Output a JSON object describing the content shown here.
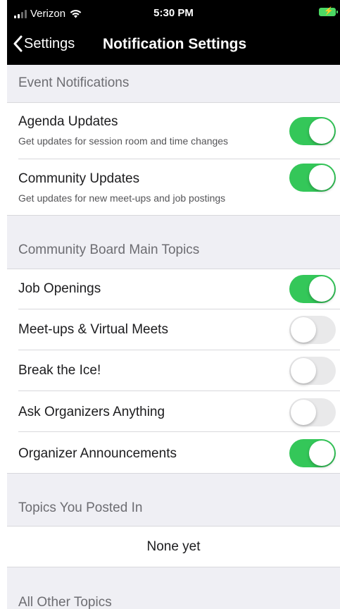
{
  "status_bar": {
    "carrier": "Verizon",
    "time": "5:30 PM",
    "battery_color": "#4cd964"
  },
  "nav": {
    "back_label": "Settings",
    "title": "Notification Settings"
  },
  "sections": {
    "event": {
      "header": "Event Notifications",
      "items": [
        {
          "title": "Agenda Updates",
          "subtitle": "Get updates for session room and time changes",
          "enabled": true
        },
        {
          "title": "Community Updates",
          "subtitle": "Get updates for new meet-ups and job postings",
          "enabled": true
        }
      ]
    },
    "community_board": {
      "header": "Community Board Main Topics",
      "items": [
        {
          "title": "Job Openings",
          "enabled": true
        },
        {
          "title": "Meet-ups & Virtual Meets",
          "enabled": false
        },
        {
          "title": "Break the Ice!",
          "enabled": false
        },
        {
          "title": "Ask Organizers Anything",
          "enabled": false
        },
        {
          "title": "Organizer Announcements",
          "enabled": true
        }
      ]
    },
    "posted_in": {
      "header": "Topics You Posted In",
      "empty_text": "None yet"
    },
    "other": {
      "header": "All Other Topics"
    }
  },
  "colors": {
    "toggle_on": "#34c759",
    "toggle_off": "#e9e9ea",
    "section_bg": "#efeff4"
  }
}
